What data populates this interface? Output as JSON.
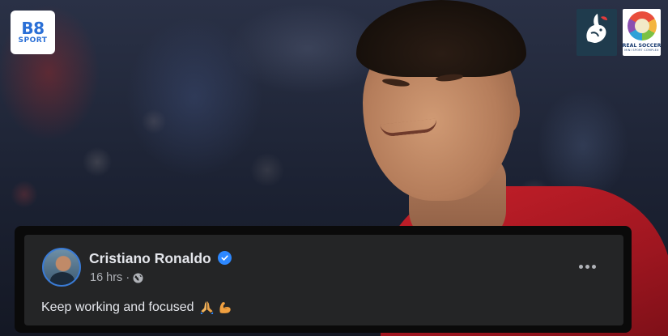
{
  "logos": {
    "b8": {
      "main": "B8",
      "sub": "SPORT"
    },
    "real_soccer": {
      "name": "REAL SOCCER",
      "tagline": "MINI SPORT COMPLEX"
    }
  },
  "post": {
    "author": "Cristiano Ronaldo",
    "verified": true,
    "timestamp": "16 hrs",
    "separator": "·",
    "audience_icon": "globe-icon",
    "text": "Keep working and focused",
    "emojis": [
      "folded-hands",
      "flexed-biceps"
    ],
    "more_icon": "more-horizontal-icon"
  },
  "colors": {
    "card_bg": "#242526",
    "name_text": "#e4e6eb",
    "meta_text": "#b0b3b8",
    "verified_badge": "#2d88ff",
    "brand_blue": "#2a6fd6"
  }
}
